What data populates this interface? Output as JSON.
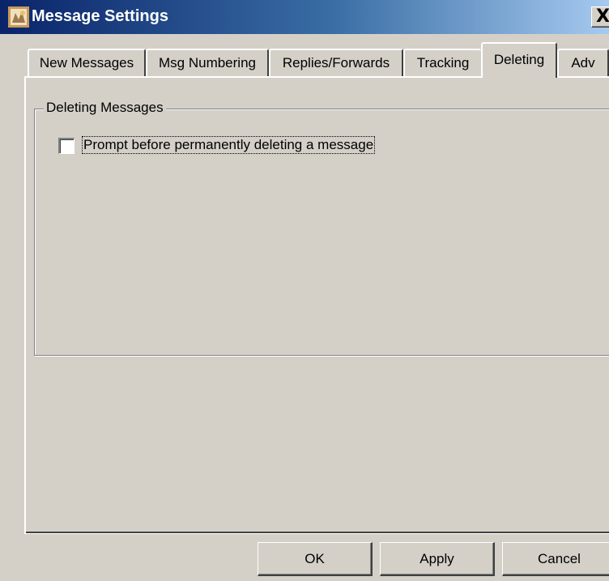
{
  "window": {
    "title": "Message Settings",
    "close_glyph": "X",
    "app_icon": "app-icon"
  },
  "tabs": [
    {
      "label": "New Messages",
      "active": false
    },
    {
      "label": "Msg Numbering",
      "active": false
    },
    {
      "label": "Replies/Forwards",
      "active": false
    },
    {
      "label": "Tracking",
      "active": false
    },
    {
      "label": "Deleting",
      "active": true
    },
    {
      "label": "Adv",
      "active": false
    }
  ],
  "deleting": {
    "group_label": "Deleting Messages",
    "prompt_checkbox": {
      "label": "Prompt before permanently deleting a message",
      "checked": false
    }
  },
  "buttons": {
    "ok": "OK",
    "apply": "Apply",
    "cancel": "Cancel"
  },
  "colors": {
    "face": "#d4d0c8",
    "title_start": "#0a246a",
    "title_end": "#a6caf0"
  }
}
